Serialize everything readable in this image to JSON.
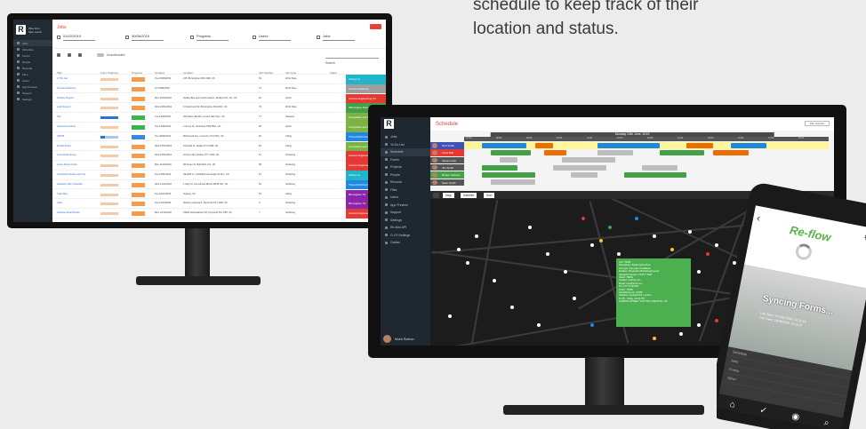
{
  "marketing_text": {
    "line1": "schedule to keep track of their",
    "line2": "location and status."
  },
  "desktop_app": {
    "logo_letter": "R",
    "org_name": "Pipe Inno",
    "org_sub": "Sam Lamb",
    "sidebar_items": [
      {
        "label": "Jobs",
        "active": true
      },
      {
        "label": "Schedule"
      },
      {
        "label": "Forms"
      },
      {
        "label": "People"
      },
      {
        "label": "Records"
      },
      {
        "label": "Files"
      },
      {
        "label": "Users"
      },
      {
        "label": "App Preview"
      },
      {
        "label": "Support"
      },
      {
        "label": "Settings"
      }
    ],
    "page_title": "Jobs",
    "filters": [
      {
        "value": "01/02/2019",
        "label": "Range",
        "icon": "calendar-icon"
      },
      {
        "value": "30/06/2019",
        "label": "Range",
        "icon": "calendar-icon"
      },
      {
        "value": "Progress",
        "label": "Filter by Progress",
        "icon": "check-icon"
      },
      {
        "value": "Users",
        "label": "Filter by User",
        "icon": "user-icon"
      },
      {
        "value": "Jobs",
        "label": "Select Type",
        "icon": "job-icon"
      }
    ],
    "toggle_label": "Unscheduled",
    "search_placeholder": "Search",
    "columns": [
      "Title",
      "Form Progress",
      "Progress",
      "Created",
      "Location",
      "Job Number",
      "Job Type",
      "Client"
    ],
    "rows": [
      {
        "title": "1 TAS Job",
        "bar": 0.0,
        "bar_color": "orange",
        "status": "Incomplete",
        "status_color": "orange",
        "created": "Tue 18/05/2019",
        "location": "345, Birmingham B33 2NB, UK",
        "num": "60",
        "type": "Work Pass",
        "client": "Acting Ltd",
        "client_color": "#1fb6c9"
      },
      {
        "title": "Furness Redstone",
        "bar": 0.0,
        "bar_color": "orange",
        "status": "Incomplete",
        "status_color": "orange",
        "created": "Fri 04/05/2019",
        "location": "",
        "num": "74",
        "type": "Work Pass",
        "client": "Furness Redstone",
        "client_color": "#9e9e9e"
      },
      {
        "title": "St Mary Support",
        "bar": 0.0,
        "bar_color": "orange",
        "status": "Incomplete",
        "status_color": "orange",
        "created": "Mon 25/03/2019",
        "location": "Dudley Bus and Coach Station, Dudley DY1 1LY, UK",
        "num": "62",
        "type": "Hydro",
        "client": "Amazon Engineering Ltd",
        "client_color": "#e53935"
      },
      {
        "title": "Leak Support",
        "bar": 0.0,
        "bar_color": "orange",
        "status": "Incomplete",
        "status_color": "orange",
        "created": "Wed 24/04/2019",
        "location": "6 Cranbrook Rd, Birmingham B12 8LD, UK",
        "num": "75",
        "type": "Work Pass",
        "client": "Warmington Power Ltd",
        "client_color": "#43a047"
      },
      {
        "title": "Ster",
        "bar": 1.0,
        "bar_color": "blue",
        "status": "Complete",
        "status_color": "green",
        "created": "Tue 16/05/2019",
        "location": "200 Saint Hall Rd, London SE1 9GL, UK",
        "num": "77",
        "type": "Sweeper",
        "client": "Georgelake and Sons",
        "client_color": "#7cb342"
      },
      {
        "title": "Greenwood Street",
        "bar": 0.0,
        "bar_color": "orange",
        "status": "Complete",
        "status_color": "green",
        "created": "Tue 13/06/2019",
        "location": "4 Grove St, Hounslow TW4 5RA, UK",
        "num": "68",
        "type": "Hydro",
        "client": "Georgelake and Sons",
        "client_color": "#7cb342"
      },
      {
        "title": "GBT05",
        "bar": 0.25,
        "bar_color": "blue",
        "status": "In Progress",
        "status_color": "blue",
        "created": "Tue 28/05/2019",
        "location": "Birchwood Ave, Coventry CV3 6PQ, UK",
        "num": "60",
        "type": "Lifting",
        "client": "Thrive RHS Point",
        "client_color": "#1e88e5"
      },
      {
        "title": "Fredeli Street",
        "bar": 0.0,
        "bar_color": "orange",
        "status": "Incomplete",
        "status_color": "orange",
        "created": "Wed 27/02/2019",
        "location": "8 Fredeli St, Dudley DY2 8HB, UK",
        "num": "59",
        "type": "Lifting",
        "client": "Georgelake and Sons",
        "client_color": "#7cb342"
      },
      {
        "title": "Anne Road Survey",
        "bar": 0.0,
        "bar_color": "orange",
        "status": "Incomplete",
        "status_color": "orange",
        "created": "Wed 27/02/2019",
        "location": "10 Anne Rd, Dudley DY7 1NW, UK",
        "num": "61",
        "type": "Surfacing",
        "client": "Amazon Engineering Ltd",
        "client_color": "#e53935"
      },
      {
        "title": "Green Street Outlet",
        "bar": 0.0,
        "bar_color": "orange",
        "status": "Incomplete",
        "status_color": "orange",
        "created": "Mon 11/03/2019",
        "location": "98 Green St, Bath BA1 2JL, UK",
        "num": "58",
        "type": "Surfacing",
        "client": "Amazon Engineering Ltd",
        "client_color": "#e53935"
      },
      {
        "title": "Chelmford Hamlet Lane Top",
        "bar": 0.0,
        "bar_color": "orange",
        "status": "Incomplete",
        "status_color": "orange",
        "created": "Tue 15/01/2019",
        "location": "Sandhill Ln, Sheffield Lane Edge S2 0LL, UK",
        "num": "57",
        "type": "Surfacing",
        "client": "Acting Ltd",
        "client_color": "#1fb6c9"
      },
      {
        "title": "Hawthorn Way Transition",
        "bar": 0.0,
        "bar_color": "orange",
        "status": "Incomplete",
        "status_color": "orange",
        "created": "Wed 14/11/2018",
        "location": "1 High St, Fernsbrook Bristol BS16 0AY, UK",
        "num": "54",
        "type": "Surfacing",
        "client": "Thrive RHS Point",
        "client_color": "#1e88e5"
      },
      {
        "title": "Cash Way",
        "bar": 0.0,
        "bar_color": "orange",
        "status": "Incomplete",
        "status_color": "orange",
        "created": "Tue 18/12/2018",
        "location": "Telepay, UK",
        "num": "15",
        "type": "Lifting",
        "client": "Birmingham TS",
        "client_color": "#8e24aa"
      },
      {
        "title": "A114",
        "bar": 0.0,
        "bar_color": "orange",
        "status": "Incomplete",
        "status_color": "orange",
        "created": "Tue 16/12/2018",
        "location": "Western Approach, Plymouth PL1 1HB, UK",
        "num": "9",
        "type": "Surfacing",
        "client": "Birmingham TS",
        "client_color": "#8e24aa"
      },
      {
        "title": "Ashdown Road Bristol",
        "bar": 0.0,
        "bar_color": "orange",
        "status": "Incomplete",
        "status_color": "orange",
        "created": "Mon 12/11/2018",
        "location": "15900 Hochsadown Rd, Plymouth PL1 2BT, UK",
        "num": "7",
        "type": "Surfacing",
        "client": "Amazon Engineering Ltd",
        "client_color": "#e53935"
      }
    ]
  },
  "schedule_app": {
    "logo_letter": "R",
    "sidebar_items": [
      {
        "label": "Jobs"
      },
      {
        "label": "To Do List"
      },
      {
        "label": "Schedule",
        "active": true
      },
      {
        "label": "Forms"
      },
      {
        "label": "Projects"
      },
      {
        "label": "People"
      },
      {
        "label": "Records"
      },
      {
        "label": "Files"
      },
      {
        "label": "Users"
      },
      {
        "label": "App Preview"
      },
      {
        "label": "Support"
      },
      {
        "label": "Settings"
      },
      {
        "label": "Re-flow API"
      },
      {
        "label": "O.I.Fl Settings"
      },
      {
        "label": "Guides"
      }
    ],
    "user_name": "Mark Barton",
    "page_title": "Schedule",
    "filter_button": "Filter Selection",
    "date_header": "Monday 24th June, 2019",
    "hours": [
      "07:00",
      "08:00",
      "09:00",
      "10:00",
      "11:00",
      "12:00",
      "13:00",
      "14:00",
      "15:00",
      "16:00",
      "17:00",
      "18:00"
    ],
    "staff": [
      {
        "name": "Rob Smith",
        "color": "#3f51b5"
      },
      {
        "name": "Chris Ball",
        "color": "#e53935"
      },
      {
        "name": "James Cork",
        "color": "#555555"
      },
      {
        "name": "Jim Smith",
        "color": "#555555"
      },
      {
        "name": "Robert Jackson",
        "color": "#43a047"
      },
      {
        "name": "Sean Smith",
        "color": "#555555"
      }
    ],
    "map_buttons": [
      "Map",
      "Satellite",
      "Sort"
    ],
    "popup_lines": [
      "Job: 75456",
      "Description: Boiled split elbow",
      "Job type: Gas pipe installation",
      "Product: Streamline Build Engineered",
      "Assigned person: HTCS 7 Staff",
      "Client: TMWL",
      "Contact: Anthony Ho",
      "Email: tmw@tmw.com",
      "Tel: 07773 123456",
      "Order: 75456",
      "Job Reference: 12345",
      "Address: Lambeth Rd, London",
      "11:45 - Today, 14:15 PM",
      "LONDON STREET, SUTTON, PRESTON, UK"
    ]
  },
  "mobile_app": {
    "title": "Re-flow",
    "syncing_text": "Syncing Forms...",
    "note_line1": "Last Sync: 16 July 2019, 10:12:15",
    "note_line2": "Last Sync: 16/08/2019 10:15:57",
    "list_items": [
      "Schedule",
      "Jobs",
      "Forms",
      "Other"
    ]
  }
}
